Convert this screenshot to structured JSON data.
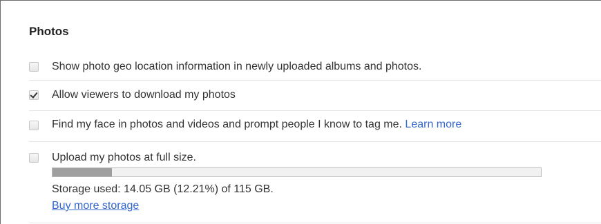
{
  "section": {
    "title": "Photos"
  },
  "settings": [
    {
      "label": "Show photo geo location information in newly uploaded albums and photos.",
      "checked": false
    },
    {
      "label": "Allow viewers to download my photos",
      "checked": true
    },
    {
      "label": "Find my face in photos and videos and prompt people I know to tag me.",
      "link_text": "Learn more",
      "checked": false
    },
    {
      "label": "Upload my photos at full size.",
      "checked": false
    }
  ],
  "storage": {
    "used_percent": 12.21,
    "summary": "Storage used: 14.05 GB (12.21%) of 115 GB.",
    "buy_more": "Buy more storage"
  }
}
